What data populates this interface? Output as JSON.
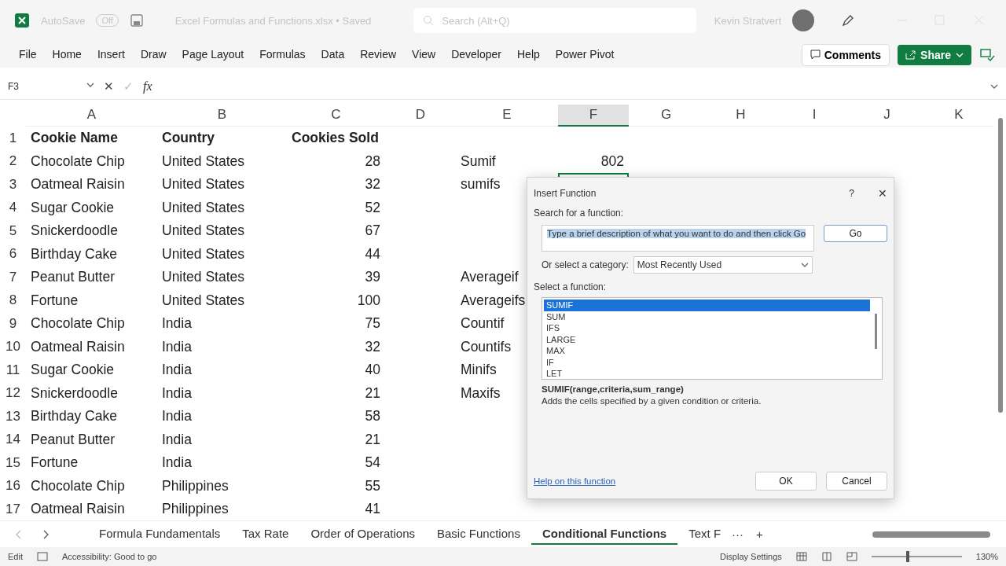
{
  "title_bar": {
    "autosave_label": "AutoSave",
    "autosave_toggle": "Off",
    "document_title": "Excel Formulas and Functions.xlsx • Saved",
    "search_placeholder": "Search (Alt+Q)",
    "user_name": "Kevin Stratvert"
  },
  "ribbon": {
    "tabs": [
      {
        "label": "File",
        "selected": false
      },
      {
        "label": "Home",
        "selected": false
      },
      {
        "label": "Insert",
        "selected": false
      },
      {
        "label": "Draw",
        "selected": false
      },
      {
        "label": "Page Layout",
        "selected": false
      },
      {
        "label": "Formulas",
        "selected": false
      },
      {
        "label": "Data",
        "selected": false
      },
      {
        "label": "Review",
        "selected": false
      },
      {
        "label": "View",
        "selected": false
      },
      {
        "label": "Developer",
        "selected": false
      },
      {
        "label": "Help",
        "selected": false
      },
      {
        "label": "Power Pivot",
        "selected": false
      }
    ],
    "comments": "Comments",
    "share": "Share"
  },
  "formula_bar": {
    "name_box": "F3",
    "cancel": "✕",
    "enter": "✓",
    "fx": "fx"
  },
  "columns": [
    {
      "label": "A",
      "selected": false
    },
    {
      "label": "B",
      "selected": false
    },
    {
      "label": "C",
      "selected": false
    },
    {
      "label": "D",
      "selected": false
    },
    {
      "label": "E",
      "selected": false
    },
    {
      "label": "F",
      "selected": true
    },
    {
      "label": "G",
      "selected": false
    },
    {
      "label": "H",
      "selected": false
    },
    {
      "label": "I",
      "selected": false
    },
    {
      "label": "J",
      "selected": false
    },
    {
      "label": "K",
      "selected": false
    }
  ],
  "rows": [
    {
      "num": "1",
      "kind": "header",
      "a": "Cookie Name",
      "b": "Country",
      "c": "Cookies Sold"
    },
    {
      "num": "2",
      "kind": "data",
      "a": "Chocolate Chip",
      "b": "United States",
      "c": "28",
      "e": "Sumif",
      "f": "802"
    },
    {
      "num": "3",
      "kind": "data",
      "a": "Oatmeal Raisin",
      "b": "United States",
      "c": "32",
      "e": "sumifs",
      "active_f": true
    },
    {
      "num": "4",
      "kind": "data",
      "a": "Sugar Cookie",
      "b": "United States",
      "c": "52"
    },
    {
      "num": "5",
      "kind": "data",
      "a": "Snickerdoodle",
      "b": "United States",
      "c": "67"
    },
    {
      "num": "6",
      "kind": "data",
      "a": "Birthday Cake",
      "b": "United States",
      "c": "44"
    },
    {
      "num": "7",
      "kind": "data",
      "a": "Peanut Butter",
      "b": "United States",
      "c": "39",
      "e": "Averageif"
    },
    {
      "num": "8",
      "kind": "data",
      "a": "Fortune",
      "b": "United States",
      "c": "100",
      "e": "Averageifs"
    },
    {
      "num": "9",
      "kind": "data",
      "a": "Chocolate Chip",
      "b": "India",
      "c": "75",
      "e": "Countif"
    },
    {
      "num": "10",
      "kind": "data",
      "a": "Oatmeal Raisin",
      "b": "India",
      "c": "32",
      "e": "Countifs"
    },
    {
      "num": "11",
      "kind": "data",
      "a": "Sugar Cookie",
      "b": "India",
      "c": "40",
      "e": "Minifs"
    },
    {
      "num": "12",
      "kind": "data",
      "a": "Snickerdoodle",
      "b": "India",
      "c": "21",
      "e": "Maxifs"
    },
    {
      "num": "13",
      "kind": "data",
      "a": "Birthday Cake",
      "b": "India",
      "c": "58"
    },
    {
      "num": "14",
      "kind": "data",
      "a": "Peanut Butter",
      "b": "India",
      "c": "21"
    },
    {
      "num": "15",
      "kind": "data",
      "a": "Fortune",
      "b": "India",
      "c": "54"
    },
    {
      "num": "16",
      "kind": "data",
      "a": "Chocolate Chip",
      "b": "Philippines",
      "c": "55"
    },
    {
      "num": "17",
      "kind": "data",
      "a": "Oatmeal Raisin",
      "b": "Philippines",
      "c": "41"
    }
  ],
  "dialog": {
    "title": "Insert Function",
    "help": "?",
    "close": "✕",
    "search_label": "Search for a function:",
    "search_value": "Type a brief description of what you want to do and then click Go",
    "go": "Go",
    "category_label": "Or select a category:",
    "category_value": "Most Recently Used",
    "list_label": "Select a function:",
    "functions": [
      {
        "name": "SUMIF",
        "selected": true
      },
      {
        "name": "SUM",
        "selected": false
      },
      {
        "name": "IFS",
        "selected": false
      },
      {
        "name": "LARGE",
        "selected": false
      },
      {
        "name": "MAX",
        "selected": false
      },
      {
        "name": "IF",
        "selected": false
      },
      {
        "name": "LET",
        "selected": false
      }
    ],
    "signature": "SUMIF(range,criteria,sum_range)",
    "description": "Adds the cells specified by a given condition or criteria.",
    "help_link": "Help on this function",
    "ok": "OK",
    "cancel": "Cancel"
  },
  "sheet_tabs": {
    "items": [
      {
        "label": "Formula Fundamentals",
        "selected": false
      },
      {
        "label": "Tax Rate",
        "selected": false
      },
      {
        "label": "Order of Operations",
        "selected": false
      },
      {
        "label": "Basic Functions",
        "selected": false
      },
      {
        "label": "Conditional Functions",
        "selected": true
      },
      {
        "label": "Text F",
        "selected": false
      }
    ],
    "more": "···",
    "add": "+"
  },
  "status_bar": {
    "mode": "Edit",
    "accessibility": "Accessibility: Good to go",
    "display_settings": "Display Settings",
    "zoom": {
      "level": 0.38,
      "reading": "130%"
    }
  }
}
